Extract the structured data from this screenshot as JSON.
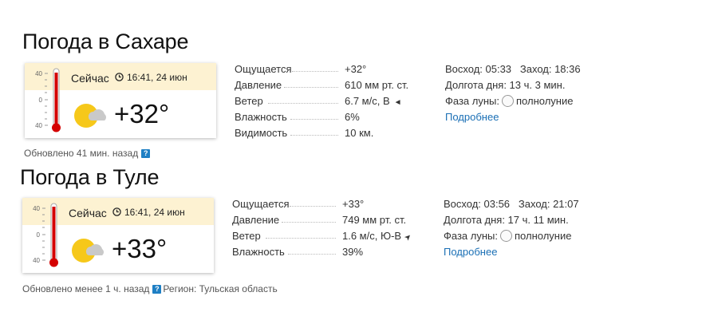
{
  "cities": [
    {
      "title": "Погода в Сахаре",
      "now_label": "Сейчас",
      "time": "16:41, 24 июн",
      "temperature": "+32°",
      "thermo_scale": [
        "40",
        "0",
        "40"
      ],
      "updated": "Обновлено 41 мин. назад",
      "help": "?",
      "details": [
        {
          "label": "Ощущается",
          "value": "+32°"
        },
        {
          "label": "Давление",
          "value": "610 мм рт. ст."
        },
        {
          "label": "Ветер",
          "value": "6.7 м/с, В",
          "arrow": "◄"
        },
        {
          "label": "Влажность",
          "value": "6%"
        },
        {
          "label": "Видимость",
          "value": "10 км."
        }
      ],
      "sunrise": "Восход: 05:33",
      "sunset": "Заход: 18:36",
      "day_length": "Долгота дня: 13 ч. 3 мин.",
      "moon_phase_label": "Фаза луны:",
      "moon_phase": "полнолуние",
      "more_link": "Подробнее"
    },
    {
      "title": "Погода в Туле",
      "now_label": "Сейчас",
      "time": "16:41, 24 июн",
      "temperature": "+33°",
      "thermo_scale": [
        "40",
        "0",
        "40"
      ],
      "updated": "Обновлено менее 1 ч. назад",
      "help": "?",
      "region": "Регион: Тульская область",
      "details": [
        {
          "label": "Ощущается",
          "value": "+33°"
        },
        {
          "label": "Давление",
          "value": "749 мм рт. ст."
        },
        {
          "label": "Ветер",
          "value": "1.6 м/с, Ю-В",
          "arrow": "➤"
        },
        {
          "label": "Влажность",
          "value": "39%"
        }
      ],
      "sunrise": "Восход: 03:56",
      "sunset": "Заход: 21:07",
      "day_length": "Долгота дня: 17 ч. 11 мин.",
      "moon_phase_label": "Фаза луны:",
      "moon_phase": "полнолуние",
      "more_link": "Подробнее"
    }
  ],
  "colors": {
    "card_header": "#fdf2d2",
    "thermo_red": "#d40000",
    "sun": "#f6c81a",
    "link": "#1a6fb5",
    "help_badge": "#1e7fc4"
  }
}
